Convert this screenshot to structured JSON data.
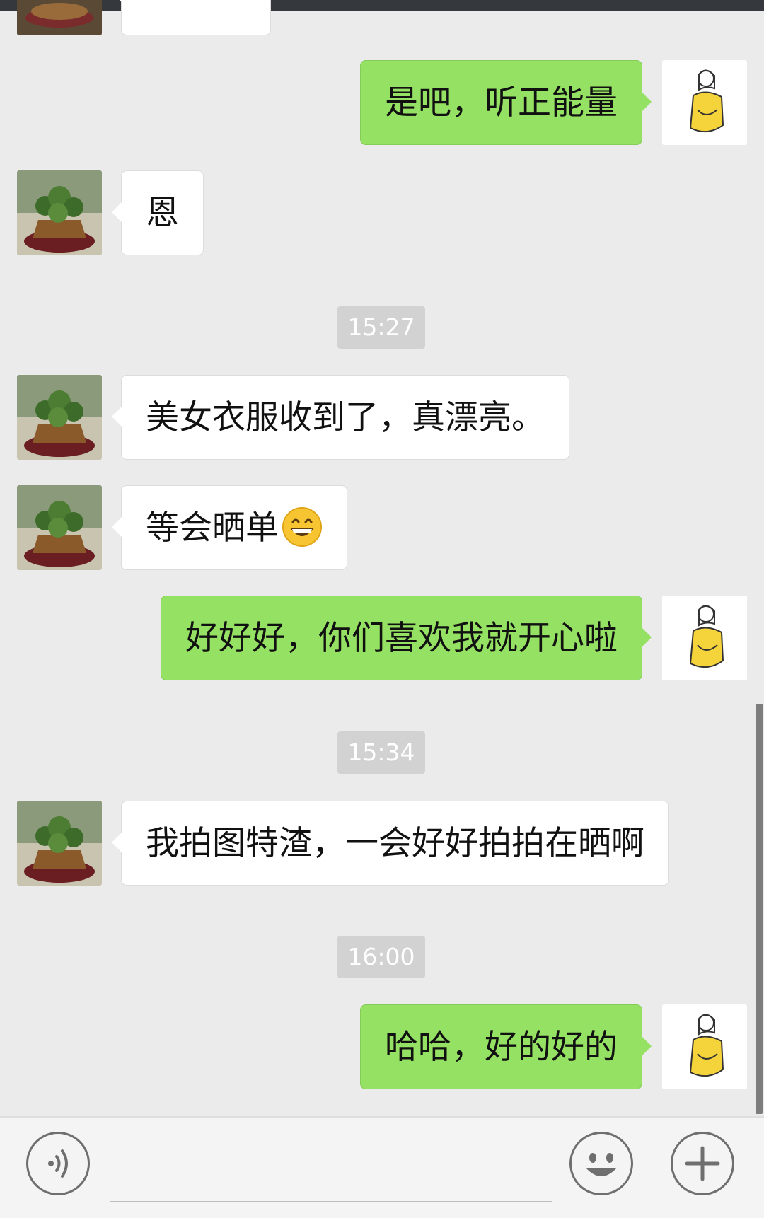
{
  "messages": [
    {
      "side": "right",
      "text": "是吧，听正能量"
    },
    {
      "side": "left",
      "text": "恩"
    },
    {
      "type": "time",
      "text": "15:27"
    },
    {
      "side": "left",
      "text": "美女衣服收到了，真漂亮。"
    },
    {
      "side": "left",
      "text": "等会晒单",
      "emoji": "grinning-face"
    },
    {
      "side": "right",
      "text": "好好好，你们喜欢我就开心啦"
    },
    {
      "type": "time",
      "text": "15:34"
    },
    {
      "side": "left",
      "text": "我拍图特渣，一会好好拍拍在晒啊"
    },
    {
      "type": "time",
      "text": "16:00"
    },
    {
      "side": "right",
      "text": "哈哈，好的好的"
    }
  ],
  "icons": {
    "voice": "voice-input-icon",
    "emoji": "emoji-icon",
    "more": "plus-icon"
  },
  "colors": {
    "sent_bubble": "#95e163",
    "received_bubble": "#ffffff",
    "background": "#ebebeb"
  }
}
